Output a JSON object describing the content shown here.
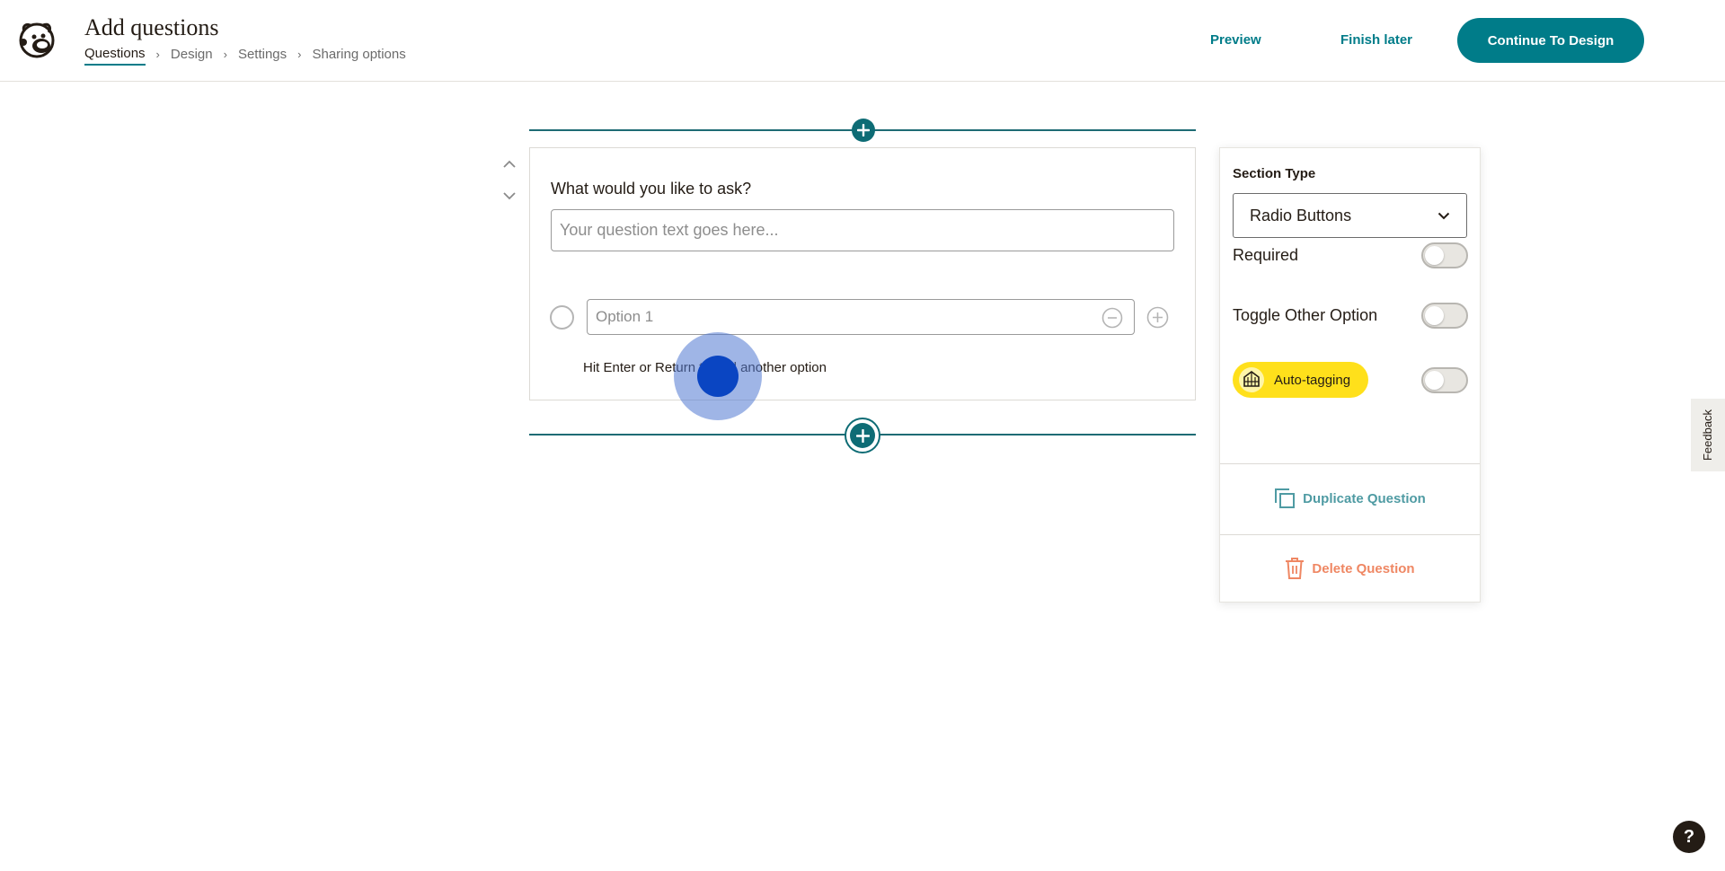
{
  "header": {
    "title": "Add questions",
    "breadcrumb": [
      "Questions",
      "Design",
      "Settings",
      "Sharing options"
    ],
    "preview_label": "Preview",
    "finish_later_label": "Finish later",
    "continue_label": "Continue To Design"
  },
  "question": {
    "label": "What would you like to ask?",
    "input_placeholder": "Your question text goes here...",
    "option_placeholder": "Option 1",
    "hint": "Hit Enter or Return to add another option"
  },
  "panel": {
    "section_type_label": "Section Type",
    "section_type_value": "Radio Buttons",
    "required_label": "Required",
    "required_on": false,
    "toggle_other_label": "Toggle Other Option",
    "toggle_other_on": false,
    "auto_tagging_label": "Auto-tagging",
    "auto_tagging_on": false,
    "duplicate_label": "Duplicate Question",
    "delete_label": "Delete Question"
  },
  "feedback_label": "Feedback",
  "help_label": "?",
  "colors": {
    "brand": "#007c89",
    "auto_tag_bg": "#ffe01b",
    "delete": "#ef8763",
    "duplicate": "#4f9ba3"
  },
  "icons": [
    "mailchimp-logo",
    "chevron-up-icon",
    "chevron-down-icon",
    "plus-icon",
    "minus-icon",
    "duplicate-icon",
    "trash-icon",
    "help-icon"
  ]
}
